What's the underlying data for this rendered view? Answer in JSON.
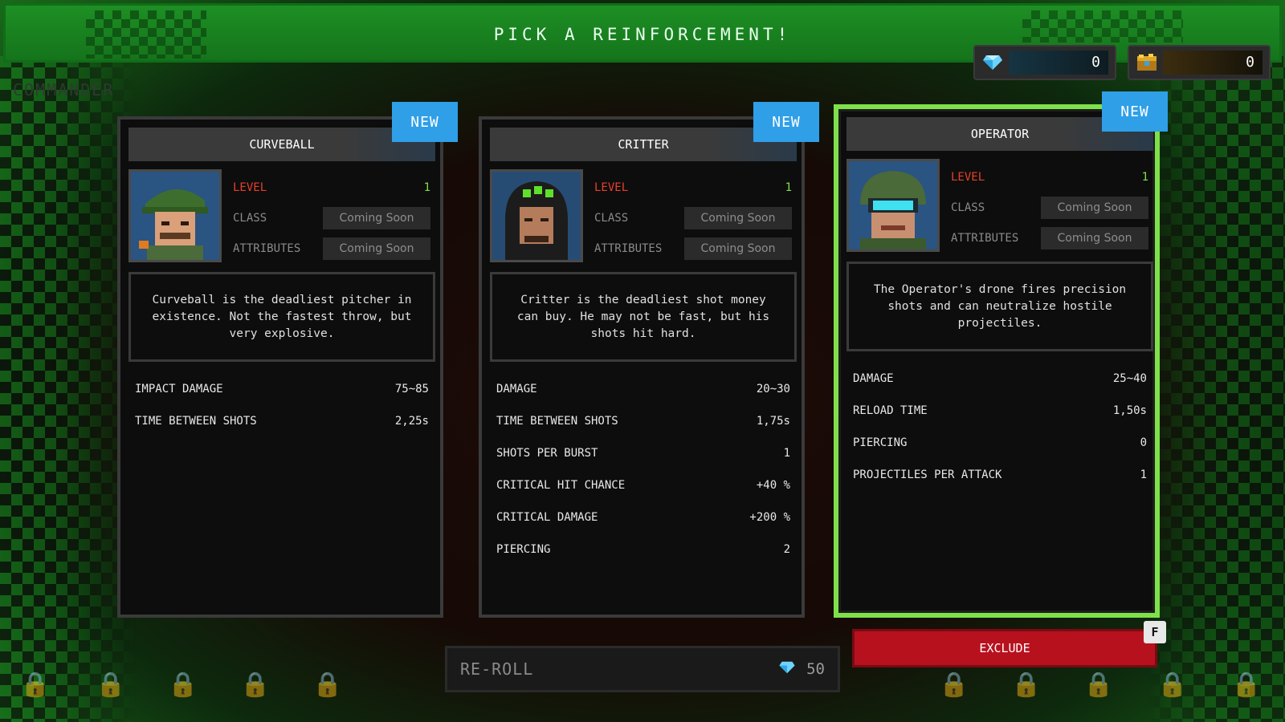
{
  "header": {
    "title": "PICK A REINFORCEMENT!"
  },
  "currencies": [
    {
      "icon": "gem-icon",
      "value": "0"
    },
    {
      "icon": "gold-chest-icon",
      "value": "0"
    }
  ],
  "commander_label": "COMMANDER",
  "info_labels": {
    "level": "LEVEL",
    "class": "CLASS",
    "attributes": "ATTRIBUTES"
  },
  "cards": [
    {
      "name": "CURVEBALL",
      "badge": "NEW",
      "level": "1",
      "class_value": "Coming Soon",
      "attributes_value": "Coming Soon",
      "description": "Curveball is the deadliest pitcher in existence. Not the fastest throw, but very explosive.",
      "stats": [
        {
          "label": "IMPACT DAMAGE",
          "value": "75~85"
        },
        {
          "label": "TIME BETWEEN SHOTS",
          "value": "2,25s"
        }
      ]
    },
    {
      "name": "CRITTER",
      "badge": "NEW",
      "level": "1",
      "class_value": "Coming Soon",
      "attributes_value": "Coming Soon",
      "description": "Critter is the deadliest shot money can buy. He may not be fast, but his shots hit hard.",
      "stats": [
        {
          "label": "DAMAGE",
          "value": "20~30"
        },
        {
          "label": "TIME BETWEEN SHOTS",
          "value": "1,75s"
        },
        {
          "label": "SHOTS PER BURST",
          "value": "1"
        },
        {
          "label": "CRITICAL HIT CHANCE",
          "value": "+40 %"
        },
        {
          "label": "CRITICAL DAMAGE",
          "value": "+200 %"
        },
        {
          "label": "PIERCING",
          "value": "2"
        }
      ]
    },
    {
      "name": "OPERATOR",
      "badge": "NEW",
      "level": "1",
      "class_value": "Coming Soon",
      "attributes_value": "Coming Soon",
      "description": "The Operator's drone fires  precision shots and can neutralize hostile projectiles.",
      "stats": [
        {
          "label": "DAMAGE",
          "value": "25~40"
        },
        {
          "label": "RELOAD TIME",
          "value": "1,50s"
        },
        {
          "label": "PIERCING",
          "value": "0"
        },
        {
          "label": "PROJECTILES PER ATTACK",
          "value": "1"
        }
      ]
    }
  ],
  "reroll": {
    "label": "RE-ROLL",
    "cost": "50",
    "icon": "gem-icon"
  },
  "exclude": {
    "label": "EXCLUDE",
    "key": "F"
  },
  "lock_slots": [
    "lock-icon",
    "lock-icon",
    "lock-icon",
    "lock-icon",
    "lock-icon",
    "lock-icon",
    "lock-icon",
    "lock-icon",
    "lock-icon",
    "lock-icon"
  ],
  "colors": {
    "selected_border": "#7ee14a",
    "new_badge": "#2f9fe8",
    "exclude": "#b8111e",
    "level_label": "#e8402a",
    "level_value": "#7ee14a"
  }
}
